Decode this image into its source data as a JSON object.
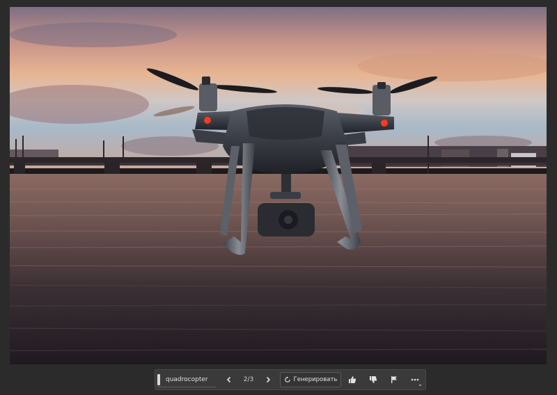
{
  "canvas": {
    "subject": "quadcopter drone over river at sunset"
  },
  "generative_bar": {
    "prompt_value": "quadrocopter",
    "prev_icon": "chevron-left-icon",
    "variation_counter": "2/3",
    "next_icon": "chevron-right-icon",
    "generate_icon": "refresh-icon",
    "generate_label": "Генерировать",
    "like_icon": "thumbs-up-icon",
    "dislike_icon": "thumbs-down-icon",
    "flag_icon": "flag-icon",
    "more_icon": "more-horizontal-icon"
  },
  "colors": {
    "workspace_bg": "#2b2b2b",
    "bar_bg": "#3a3a3a",
    "text": "#e2e2e2"
  }
}
